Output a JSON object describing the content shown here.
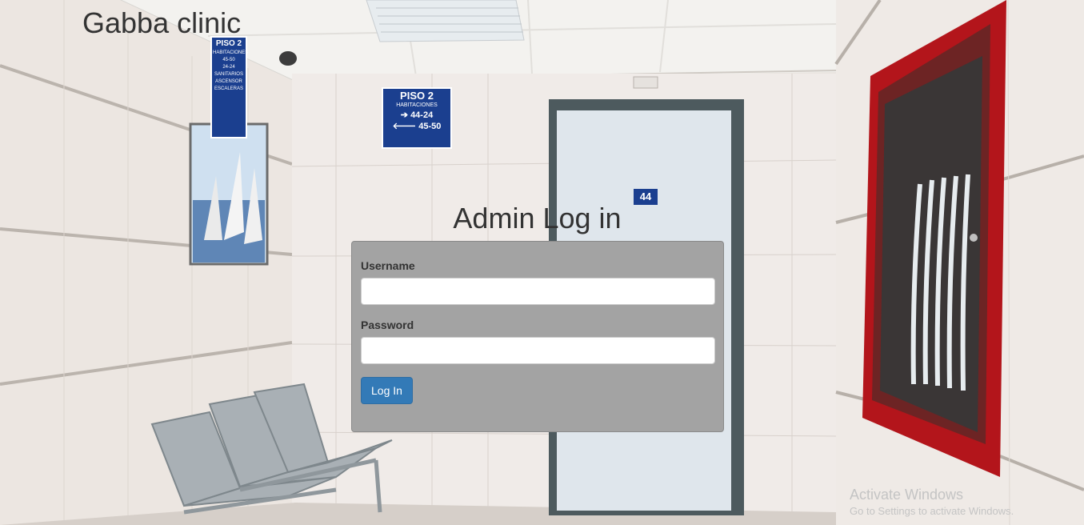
{
  "site": {
    "brand": "Gabba clinic"
  },
  "login": {
    "title": "Admin Log in",
    "username_label": "Username",
    "username_value": "",
    "password_label": "Password",
    "password_value": "",
    "submit_label": "Log In"
  },
  "background": {
    "sign_left": {
      "title": "PISO 2",
      "lines": [
        "HABITACIONES",
        "45-50",
        "24-24",
        "SANITARIOS",
        "ASCENSOR",
        "ESCALERAS"
      ]
    },
    "sign_center": {
      "title": "PISO 2",
      "subtitle": "HABITACIONES",
      "room_a": "44-24",
      "room_b": "45-50"
    },
    "door_number": "44"
  },
  "watermark": {
    "title": "Activate Windows",
    "subtitle": "Go to Settings to activate Windows."
  },
  "colors": {
    "button": "#337ab7",
    "panel": "#a3a3a3",
    "sign": "#1b3f8f",
    "cabinet": "#b91c1c"
  }
}
